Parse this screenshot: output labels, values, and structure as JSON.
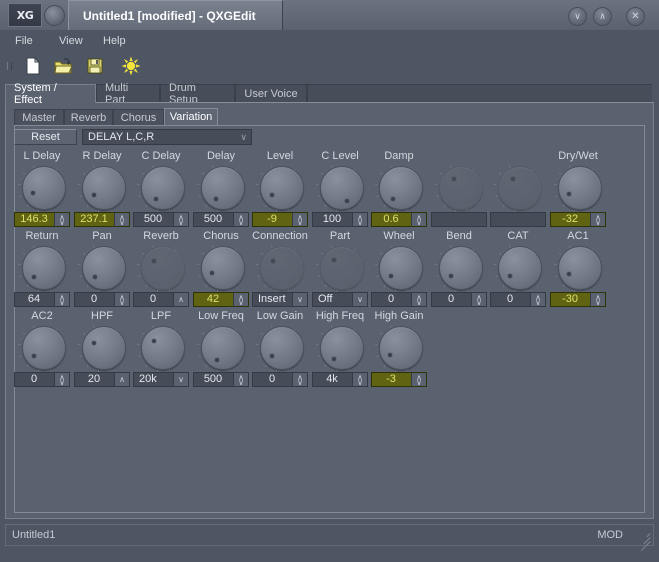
{
  "window": {
    "logo": "XG",
    "title": "Untitled1 [modified] - QXGEdit",
    "controls": {
      "minimize": "∨",
      "maximize": "∧",
      "close": "✕"
    }
  },
  "menu": {
    "items": [
      "File",
      "View",
      "Help"
    ]
  },
  "toolbar": {
    "items": [
      {
        "name": "new-file-icon",
        "label": "New"
      },
      {
        "name": "open-folder-icon",
        "label": "Open"
      },
      {
        "name": "save-floppy-icon",
        "label": "Save"
      },
      {
        "name": "sun-burst-icon",
        "label": "Randomize"
      }
    ]
  },
  "tabs_outer": {
    "items": [
      "System / Effect",
      "Multi Part",
      "Drum Setup",
      "User Voice"
    ],
    "selected": "System / Effect"
  },
  "tabs_inner": {
    "items": [
      "Master",
      "Reverb",
      "Chorus",
      "Variation"
    ],
    "selected": "Variation"
  },
  "controls": {
    "reset_label": "Reset",
    "preset_value": "DELAY L,C,R",
    "preset_arrow": "∨"
  },
  "grid": {
    "rows": [
      [
        {
          "label": "L Delay",
          "value": "146.3",
          "kind": "spin",
          "highlight": true,
          "angle": 196,
          "disabled": false
        },
        {
          "label": "R Delay",
          "value": "237.1",
          "kind": "spin",
          "highlight": true,
          "angle": 208,
          "disabled": false
        },
        {
          "label": "C Delay",
          "value": "500",
          "kind": "spin",
          "highlight": false,
          "angle": 232,
          "disabled": false
        },
        {
          "label": "Delay",
          "value": "500",
          "kind": "spin",
          "highlight": false,
          "angle": 232,
          "disabled": false
        },
        {
          "label": "Level",
          "value": "-9",
          "kind": "spin",
          "highlight": true,
          "angle": 208,
          "disabled": false
        },
        {
          "label": "C Level",
          "value": "100",
          "kind": "spin",
          "highlight": false,
          "angle": 290,
          "disabled": false
        },
        {
          "label": "Damp",
          "value": "0.6",
          "kind": "spin",
          "highlight": true,
          "angle": 228,
          "disabled": false
        },
        {
          "label": "",
          "value": "",
          "kind": "empty",
          "highlight": false,
          "angle": 130,
          "disabled": true
        },
        {
          "label": "",
          "value": "",
          "kind": "empty",
          "highlight": false,
          "angle": 130,
          "disabled": true
        },
        {
          "label": "Dry/Wet",
          "value": "-32",
          "kind": "spin",
          "highlight": true,
          "angle": 204,
          "disabled": false
        }
      ],
      [
        {
          "label": "Return",
          "value": "64",
          "kind": "spin",
          "highlight": false,
          "angle": 216,
          "disabled": false
        },
        {
          "label": "Pan",
          "value": "0",
          "kind": "spin",
          "highlight": false,
          "angle": 218,
          "disabled": false
        },
        {
          "label": "Reverb",
          "value": "0",
          "kind": "spin-u",
          "highlight": false,
          "angle": 140,
          "disabled": true
        },
        {
          "label": "Chorus",
          "value": "42",
          "kind": "spin",
          "highlight": true,
          "angle": 200,
          "disabled": false
        },
        {
          "label": "Connection",
          "value": "Insert",
          "kind": "combo",
          "highlight": false,
          "angle": 140,
          "disabled": true
        },
        {
          "label": "Part",
          "value": "Off",
          "kind": "combo",
          "highlight": false,
          "angle": 135,
          "disabled": true
        },
        {
          "label": "Wheel",
          "value": "0",
          "kind": "spin",
          "highlight": false,
          "angle": 214,
          "disabled": false
        },
        {
          "label": "Bend",
          "value": "0",
          "kind": "spin",
          "highlight": false,
          "angle": 212,
          "disabled": false
        },
        {
          "label": "CAT",
          "value": "0",
          "kind": "spin",
          "highlight": false,
          "angle": 214,
          "disabled": false
        },
        {
          "label": "AC1",
          "value": "-30",
          "kind": "spin",
          "highlight": true,
          "angle": 202,
          "disabled": false
        }
      ],
      [
        {
          "label": "AC2",
          "value": "0",
          "kind": "spin",
          "highlight": false,
          "angle": 214,
          "disabled": false
        },
        {
          "label": "HPF",
          "value": "20",
          "kind": "spin-u",
          "highlight": false,
          "angle": 152,
          "disabled": false
        },
        {
          "label": "LPF",
          "value": "20k",
          "kind": "combo",
          "highlight": false,
          "angle": 143,
          "disabled": false
        },
        {
          "label": "Low Freq",
          "value": "500",
          "kind": "spin",
          "highlight": false,
          "angle": 238,
          "disabled": false
        },
        {
          "label": "Low Gain",
          "value": "0",
          "kind": "spin",
          "highlight": false,
          "angle": 212,
          "disabled": false
        },
        {
          "label": "High Freq",
          "value": "4k",
          "kind": "spin",
          "highlight": false,
          "angle": 228,
          "disabled": false
        },
        {
          "label": "High Gain",
          "value": "-3",
          "kind": "spin",
          "highlight": true,
          "angle": 206,
          "disabled": false
        }
      ]
    ]
  },
  "statusbar": {
    "left": "Untitled1",
    "right": "MOD"
  },
  "colors": {
    "window_bg": "#4e5663",
    "panel_bg": "#5a6270",
    "field_bg": "#464d59",
    "highlight_bg": "#5f6312",
    "highlight_fg": "#dde36a",
    "text": "#d2d6dd"
  }
}
